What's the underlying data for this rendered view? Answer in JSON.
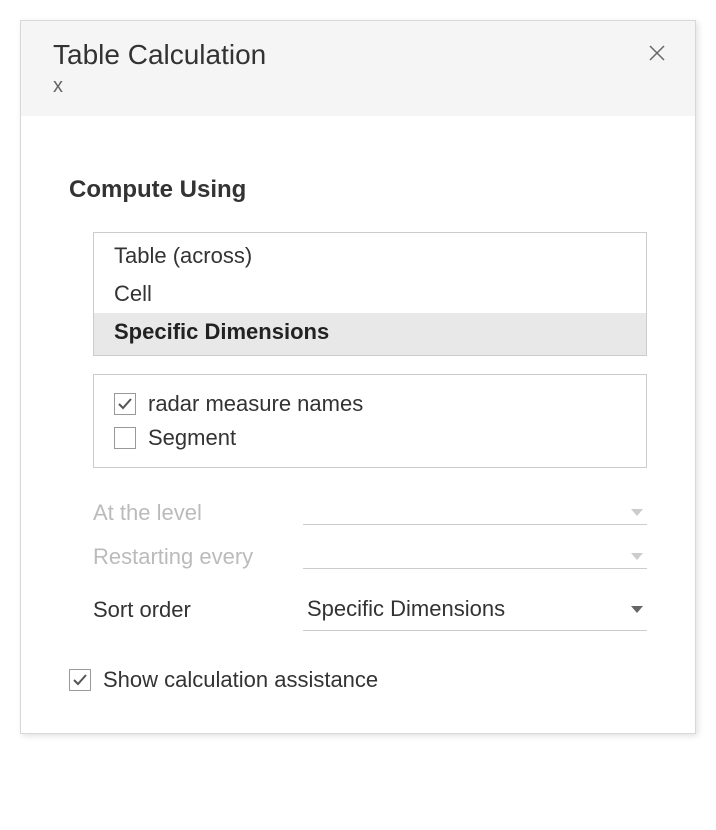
{
  "dialog": {
    "title": "Table Calculation",
    "subtitle": "x"
  },
  "compute_using": {
    "title": "Compute Using",
    "options": {
      "table_across": "Table (across)",
      "cell": "Cell",
      "specific_dimensions": "Specific Dimensions"
    },
    "selected": "specific_dimensions"
  },
  "dimensions": {
    "radar_measure": "radar measure names",
    "segment": "Segment",
    "checked": {
      "radar_measure": true,
      "segment": false
    }
  },
  "controls": {
    "at_the_level": {
      "label": "At the level",
      "value": ""
    },
    "restarting_every": {
      "label": "Restarting every",
      "value": ""
    },
    "sort_order": {
      "label": "Sort order",
      "value": "Specific Dimensions"
    }
  },
  "assistance": {
    "show_label": "Show calculation assistance",
    "checked": true
  }
}
